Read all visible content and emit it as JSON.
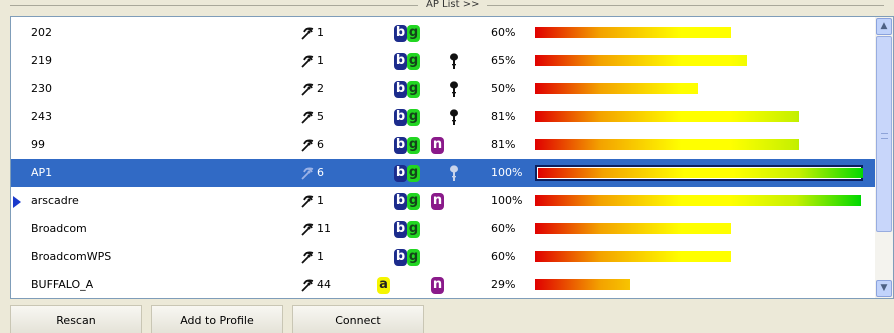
{
  "group_title": "AP List >>",
  "rows": [
    {
      "ssid": "202",
      "channel": "1",
      "b": true,
      "g": true,
      "n": false,
      "a": false,
      "secured": false,
      "signal": "60%",
      "signal_fraction": 0.6,
      "selected": false,
      "connected": false
    },
    {
      "ssid": "219",
      "channel": "1",
      "b": true,
      "g": true,
      "n": false,
      "a": false,
      "secured": true,
      "signal": "65%",
      "signal_fraction": 0.65,
      "selected": false,
      "connected": false
    },
    {
      "ssid": "230",
      "channel": "2",
      "b": true,
      "g": true,
      "n": false,
      "a": false,
      "secured": true,
      "signal": "50%",
      "signal_fraction": 0.5,
      "selected": false,
      "connected": false
    },
    {
      "ssid": "243",
      "channel": "5",
      "b": true,
      "g": true,
      "n": false,
      "a": false,
      "secured": true,
      "signal": "81%",
      "signal_fraction": 0.81,
      "selected": false,
      "connected": false
    },
    {
      "ssid": "99",
      "channel": "6",
      "b": true,
      "g": true,
      "n": true,
      "a": false,
      "secured": false,
      "signal": "81%",
      "signal_fraction": 0.81,
      "selected": false,
      "connected": false
    },
    {
      "ssid": "AP1",
      "channel": "6",
      "b": true,
      "g": true,
      "n": false,
      "a": false,
      "secured": true,
      "signal": "100%",
      "signal_fraction": 1.0,
      "selected": true,
      "connected": false
    },
    {
      "ssid": "arscadre",
      "channel": "1",
      "b": true,
      "g": true,
      "n": true,
      "a": false,
      "secured": false,
      "signal": "100%",
      "signal_fraction": 1.0,
      "selected": false,
      "connected": true
    },
    {
      "ssid": "Broadcom",
      "channel": "11",
      "b": true,
      "g": true,
      "n": false,
      "a": false,
      "secured": false,
      "signal": "60%",
      "signal_fraction": 0.6,
      "selected": false,
      "connected": false
    },
    {
      "ssid": "BroadcomWPS",
      "channel": "1",
      "b": true,
      "g": true,
      "n": false,
      "a": false,
      "secured": false,
      "signal": "60%",
      "signal_fraction": 0.6,
      "selected": false,
      "connected": false
    },
    {
      "ssid": "BUFFALO_A",
      "channel": "44",
      "b": false,
      "g": false,
      "n": true,
      "a": true,
      "secured": false,
      "signal": "29%",
      "signal_fraction": 0.29,
      "selected": false,
      "connected": false
    }
  ],
  "badge_labels": {
    "b": "b",
    "g": "g",
    "n": "n",
    "a": "a"
  },
  "buttons": {
    "rescan": "Rescan",
    "add_to_profile": "Add to Profile",
    "connect": "Connect"
  },
  "colors": {
    "selection": "#316ac5",
    "badge_b": "#1c2c8c",
    "badge_g": "#22d622",
    "badge_n": "#8a1a8a",
    "badge_a": "#f5f500"
  },
  "icons": {
    "channel": "antenna-icon",
    "security": "key-icon",
    "connected": "arrow-right-icon"
  }
}
